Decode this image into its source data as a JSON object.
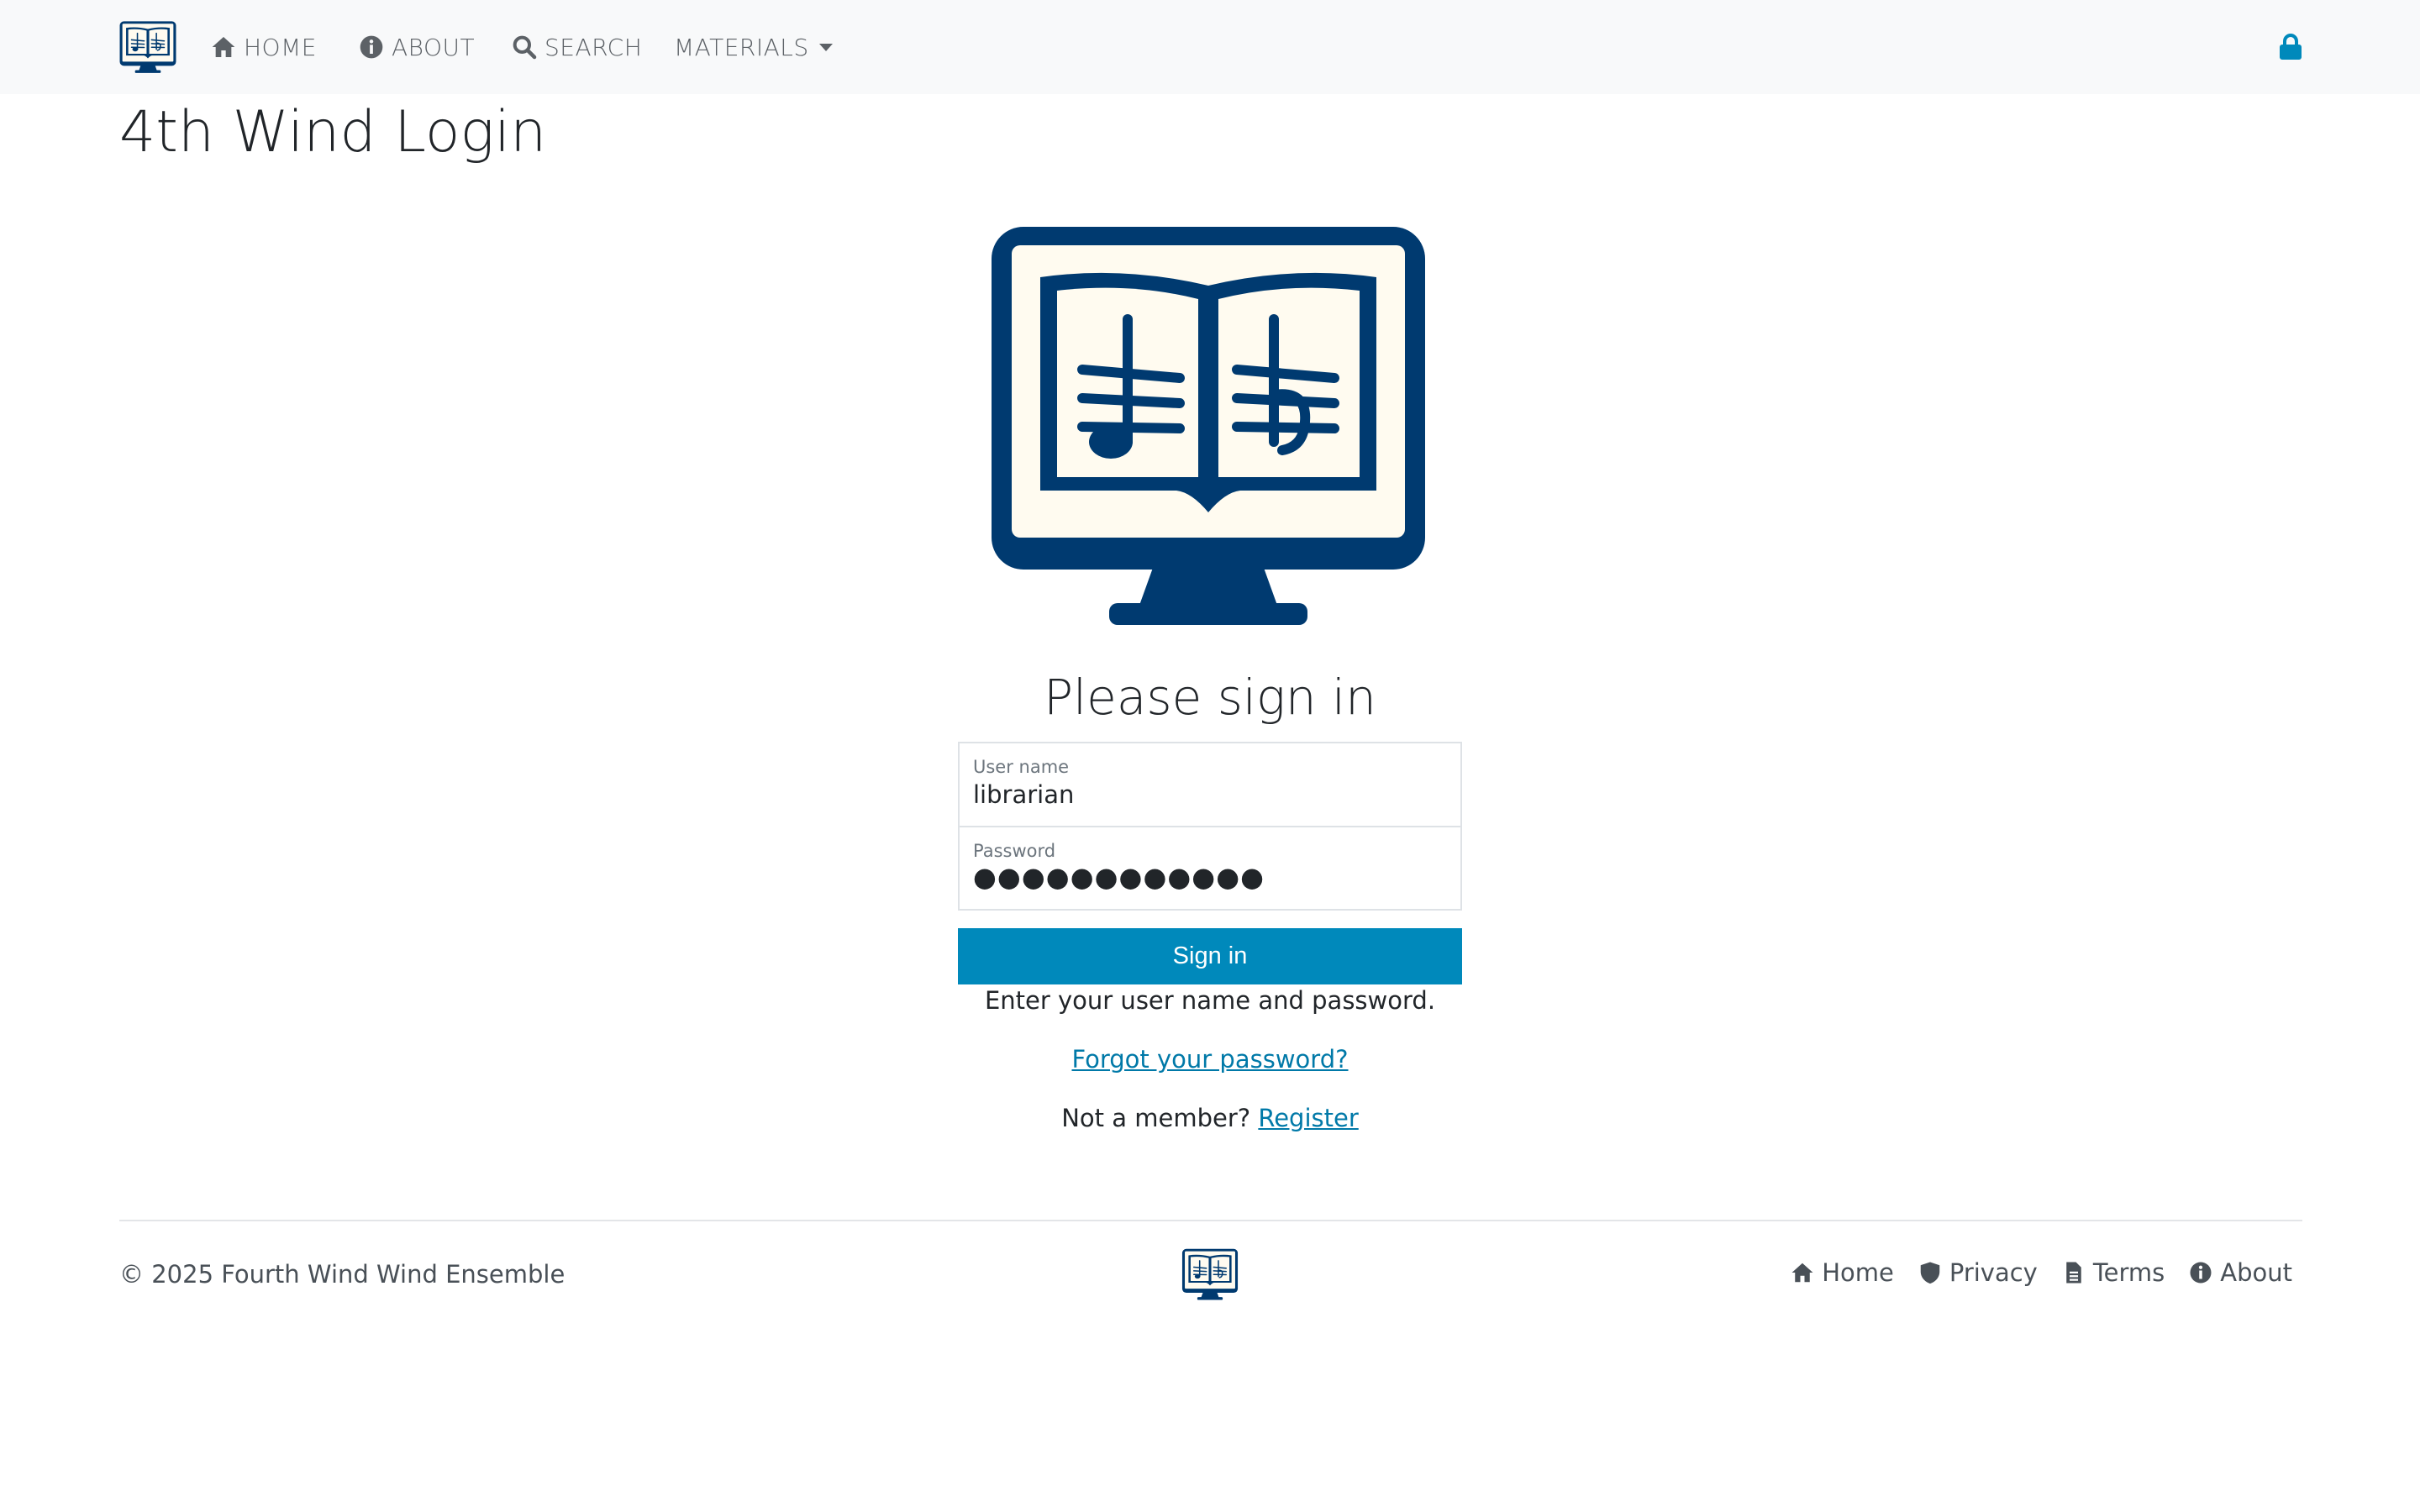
{
  "nav": {
    "home": "HOME",
    "about": "ABOUT",
    "search": "SEARCH",
    "materials": "MATERIALS"
  },
  "page": {
    "title": "4th Wind Login"
  },
  "signin": {
    "heading": "Please sign in",
    "username_label": "User name",
    "username_value": "librarian",
    "password_label": "Password",
    "password_value": "●●●●●●●●●●●●",
    "button": "Sign in",
    "help": "Enter your user name and password.",
    "forgot": "Forgot your password?",
    "not_member": "Not a member?",
    "register": "Register"
  },
  "footer": {
    "copyright": "© 2025 Fourth Wind Wind Ensemble",
    "links": [
      "Home",
      "Privacy",
      "Terms",
      "About"
    ]
  },
  "colors": {
    "brand": "#003a70",
    "accent": "#0089bb",
    "link": "#0079a8",
    "navbar_bg": "#f8f9fa",
    "screen_fill": "#fffbf0"
  },
  "icons": {
    "nav": [
      "home-icon",
      "info-icon",
      "search-icon",
      "caret-down-icon",
      "lock-icon"
    ],
    "footer": [
      "home-icon",
      "shield-icon",
      "document-icon",
      "info-icon"
    ],
    "logo": "monitor-music-book-logo"
  }
}
